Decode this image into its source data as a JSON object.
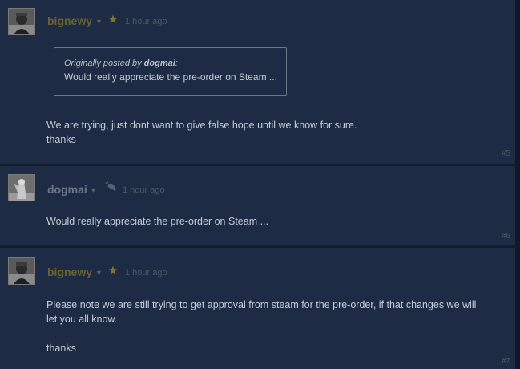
{
  "posts": [
    {
      "author": "bignewy",
      "author_type": "developer",
      "badge": "star-icon",
      "time": "1 hour ago",
      "quote": {
        "prefix": "Originally posted by ",
        "quoted_author": "dogmai",
        "suffix": ":",
        "text": "Would really appreciate the pre-order on Steam ..."
      },
      "lines": [
        "We are trying, just dont want to give false hope until we know for sure.",
        "thanks"
      ],
      "number": "#5"
    },
    {
      "author": "dogmai",
      "author_type": "user",
      "badge": "gamepad-icon",
      "time": "1 hour ago",
      "lines": [
        "Would really appreciate the pre-order on Steam ..."
      ],
      "number": "#6"
    },
    {
      "author": "bignewy",
      "author_type": "developer",
      "badge": "star-icon",
      "time": "1 hour ago",
      "lines": [
        "Please note we are still trying to get approval from steam for the pre-order, if that changes we will",
        "let you all know.",
        "",
        "thanks"
      ],
      "number": "#7"
    }
  ],
  "colors": {
    "background": "#1d2c44",
    "developer_name": "#6a6230",
    "user_name": "#6c7684",
    "body_text": "#c4cbd4"
  }
}
